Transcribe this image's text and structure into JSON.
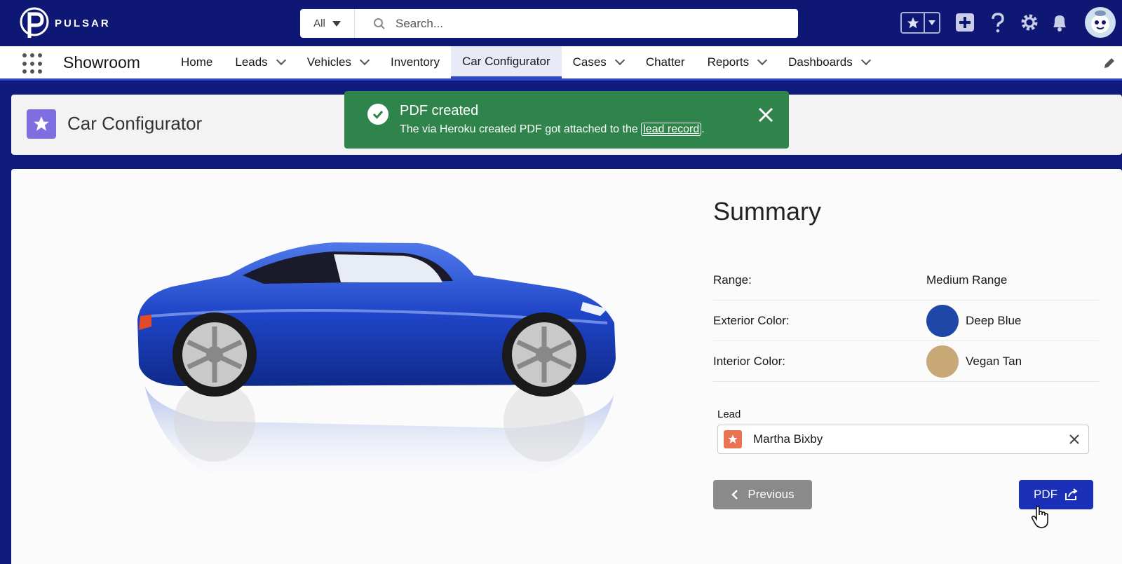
{
  "brand": {
    "name": "PULSAR"
  },
  "search": {
    "scope": "All",
    "placeholder": "Search..."
  },
  "header_icons": [
    "favorites-star-icon",
    "favorites-dropdown-icon",
    "global-add-icon",
    "help-icon",
    "setup-gear-icon",
    "notifications-bell-icon",
    "avatar"
  ],
  "nav": {
    "app_name": "Showroom",
    "items": [
      {
        "label": "Home",
        "dropdown": false
      },
      {
        "label": "Leads",
        "dropdown": true
      },
      {
        "label": "Vehicles",
        "dropdown": true
      },
      {
        "label": "Inventory",
        "dropdown": false
      },
      {
        "label": "Car Configurator",
        "dropdown": false,
        "active": true
      },
      {
        "label": "Cases",
        "dropdown": true
      },
      {
        "label": "Chatter",
        "dropdown": false
      },
      {
        "label": "Reports",
        "dropdown": true
      },
      {
        "label": "Dashboards",
        "dropdown": true
      }
    ]
  },
  "page": {
    "title": "Car Configurator"
  },
  "toast": {
    "title": "PDF created",
    "message_before": "The via Heroku created PDF got attached to the ",
    "link_text": "lead record",
    "message_after": ".",
    "color": "#2e844a"
  },
  "summary": {
    "title": "Summary",
    "range_label": "Range:",
    "range_value": "Medium Range",
    "exterior_label": "Exterior Color:",
    "exterior_value": "Deep Blue",
    "exterior_color": "#1e47a8",
    "interior_label": "Interior Color:",
    "interior_value": "Vegan Tan",
    "interior_color": "#c9a878",
    "lead_label": "Lead",
    "lead_name": "Martha Bixby"
  },
  "buttons": {
    "previous": "Previous",
    "pdf": "PDF"
  },
  "colors": {
    "header": "#0e1874",
    "accent": "#1b2fb8"
  }
}
